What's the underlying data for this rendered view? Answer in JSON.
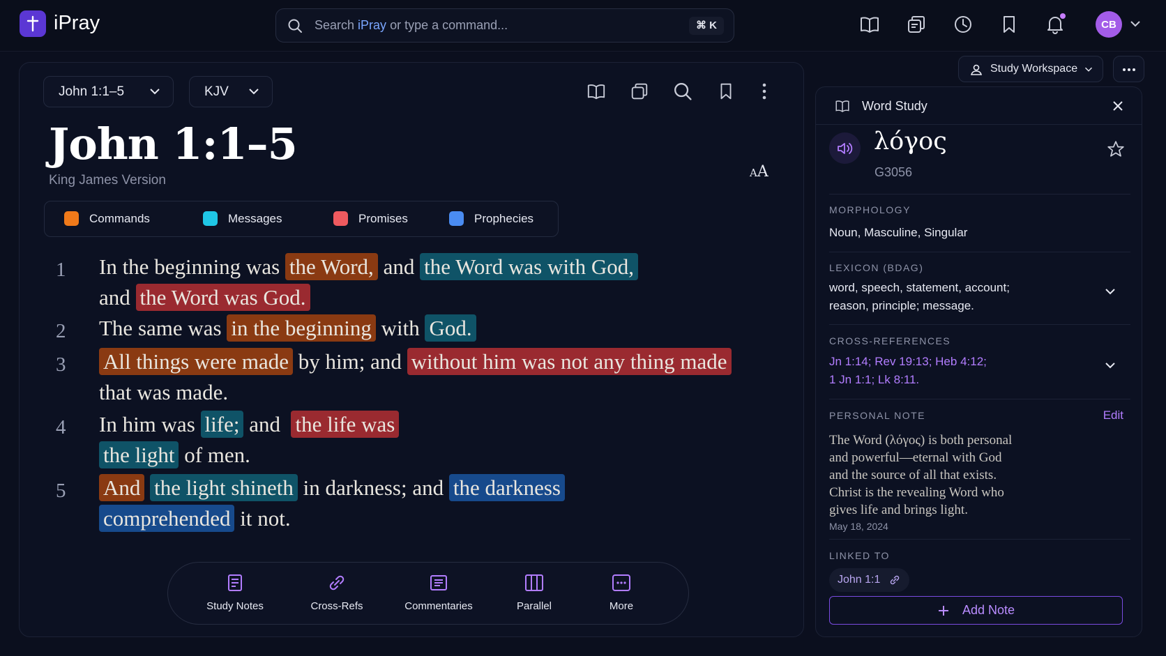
{
  "app": {
    "name": "iPray"
  },
  "search": {
    "placeholder_pre": "Search ",
    "placeholder_brand": "iPray",
    "placeholder_post": " or type a command...",
    "shortcut": "⌘ K"
  },
  "user": {
    "initials": "CB"
  },
  "topicons": [
    "book-icon",
    "copy-icon",
    "history-icon",
    "bookmark-icon",
    "bell-icon"
  ],
  "reader": {
    "passage": "John 1:1–5",
    "version": "KJV",
    "title": "John 1:1–5",
    "subtitle": "King James Version",
    "fontsize": {
      "small": "A",
      "large": "A"
    }
  },
  "legend": [
    {
      "label": "Commands",
      "color": "#f07a1a"
    },
    {
      "label": "Messages",
      "color": "#1fc7e6"
    },
    {
      "label": "Promises",
      "color": "#ef5a5f"
    },
    {
      "label": "Prophecies",
      "color": "#4a8cf2"
    }
  ],
  "verses": [
    {
      "n": "1",
      "lines": [
        [
          {
            "t": "In the beginning was "
          },
          {
            "t": "the Word,",
            "h": "o"
          },
          {
            "t": " and "
          },
          {
            "t": "the Word was with God,",
            "h": "t"
          }
        ],
        [
          {
            "t": "and "
          },
          {
            "t": "the Word was God.",
            "h": "r"
          }
        ]
      ]
    },
    {
      "n": "2",
      "lines": [
        [
          {
            "t": "The same was "
          },
          {
            "t": "in the beginning",
            "h": "o"
          },
          {
            "t": " with "
          },
          {
            "t": "God.",
            "h": "t"
          }
        ]
      ]
    },
    {
      "n": "3",
      "lines": [
        [
          {
            "t": "All things were made",
            "h": "o"
          },
          {
            "t": " by him; and "
          },
          {
            "t": "without him was not any thing made",
            "h": "r"
          }
        ],
        [
          {
            "t": "that was made."
          }
        ]
      ]
    },
    {
      "n": "4",
      "lines": [
        [
          {
            "t": "In him was "
          },
          {
            "t": "life;",
            "h": "t"
          },
          {
            "t": " and  "
          },
          {
            "t": "the life was",
            "h": "r"
          }
        ],
        [
          {
            "t": "the light",
            "h": "t"
          },
          {
            "t": " of men."
          }
        ]
      ]
    },
    {
      "n": "5",
      "lines": [
        [
          {
            "t": "And",
            "h": "o"
          },
          {
            "t": " "
          },
          {
            "t": "the light shineth",
            "h": "t"
          },
          {
            "t": " in darkness; and "
          },
          {
            "t": "the darkness",
            "h": "b"
          }
        ],
        [
          {
            "t": "comprehended",
            "h": "b"
          },
          {
            "t": " it not."
          }
        ]
      ]
    }
  ],
  "toolbar": [
    {
      "label": "Study Notes",
      "icon": "study-notes-icon"
    },
    {
      "label": "Cross-Refs",
      "icon": "link-icon"
    },
    {
      "label": "Commentaries",
      "icon": "commentary-icon"
    },
    {
      "label": "Parallel",
      "icon": "parallel-icon"
    },
    {
      "label": "More",
      "icon": "more-icon"
    }
  ],
  "workspace": {
    "label": "Study Workspace"
  },
  "wordstudy": {
    "header": "Word Study",
    "word": "λόγος",
    "strongs": "G3056",
    "morphology_title": "MORPHOLOGY",
    "morphology": "Noun, Masculine, Singular",
    "lexicon_title": "LEXICON (BDAG)",
    "lexicon_l1": "word, speech, statement, account;",
    "lexicon_l2": "reason, principle; message.",
    "xref_title": "CROSS-REFERENCES",
    "xref_l1": "Jn 1:14; Rev 19:13; Heb 4:12;",
    "xref_l2": "1 Jn 1:1; Lk 8:11.",
    "note_title": "PERSONAL NOTE",
    "note_edit": "Edit",
    "note_lines": [
      "The Word (λόγος) is both personal",
      "and powerful—eternal with God",
      "and the source of all that exists.",
      "Christ is the revealing Word who",
      "gives life and brings light."
    ],
    "note_date": "May 18, 2024",
    "linked_title": "LINKED TO",
    "linked": "John 1:1",
    "add_note": "Add Note"
  }
}
